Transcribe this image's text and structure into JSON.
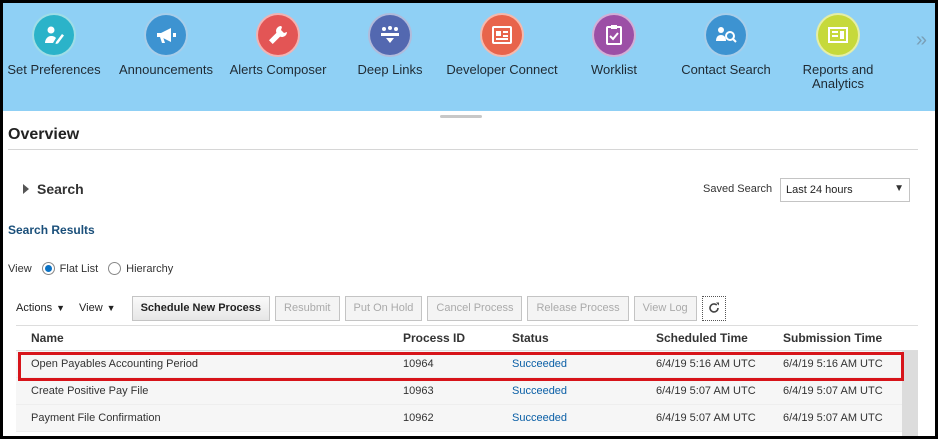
{
  "springboard": {
    "items": [
      {
        "label": "Set Preferences",
        "icon": "preferences-icon",
        "color": "#2bb3c9"
      },
      {
        "label": "Announcements",
        "icon": "megaphone-icon",
        "color": "#3d93d1"
      },
      {
        "label": "Alerts Composer",
        "icon": "wrench-icon",
        "color": "#e35555"
      },
      {
        "label": "Deep Links",
        "icon": "deep-links-icon",
        "color": "#5368b0"
      },
      {
        "label": "Developer Connect",
        "icon": "developer-icon",
        "color": "#e8644b"
      },
      {
        "label": "Worklist",
        "icon": "clipboard-check-icon",
        "color": "#9c4fa6"
      },
      {
        "label": "Contact Search",
        "icon": "contact-search-icon",
        "color": "#3d93d1"
      },
      {
        "label": "Reports and Analytics",
        "icon": "reports-icon",
        "color": "#c6d93b"
      }
    ],
    "more": "»",
    "background": "#8fd0f5"
  },
  "page": {
    "title": "Overview"
  },
  "search": {
    "label": "Search",
    "saved_search_label": "Saved Search",
    "saved_search_value": "Last 24 hours"
  },
  "results": {
    "heading": "Search Results",
    "view_label": "View",
    "view_options": [
      "Flat List",
      "Hierarchy"
    ],
    "view_selected": "Flat List"
  },
  "toolbar": {
    "actions": "Actions",
    "view": "View",
    "schedule": "Schedule New Process",
    "resubmit": "Resubmit",
    "put_on_hold": "Put On Hold",
    "cancel": "Cancel Process",
    "release": "Release Process",
    "view_log": "View Log"
  },
  "table": {
    "columns": [
      "Name",
      "Process ID",
      "Status",
      "Scheduled Time",
      "Submission Time"
    ],
    "rows": [
      {
        "name": "Open Payables Accounting Period",
        "pid": "10964",
        "status": "Succeeded",
        "scheduled": "6/4/19 5:16 AM UTC",
        "submitted": "6/4/19 5:16 AM UTC"
      },
      {
        "name": "Create Positive Pay File",
        "pid": "10963",
        "status": "Succeeded",
        "scheduled": "6/4/19 5:07 AM UTC",
        "submitted": "6/4/19 5:07 AM UTC"
      },
      {
        "name": "Payment File Confirmation",
        "pid": "10962",
        "status": "Succeeded",
        "scheduled": "6/4/19 5:07 AM UTC",
        "submitted": "6/4/19 5:07 AM UTC"
      }
    ]
  },
  "colors": {
    "highlight": "#d7141a",
    "link": "#0a5fa6"
  }
}
